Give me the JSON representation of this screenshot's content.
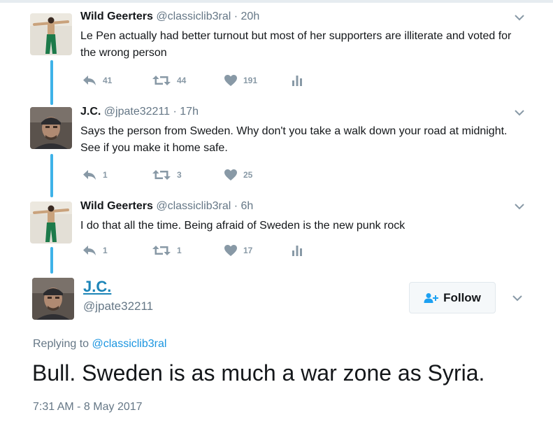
{
  "tweets": [
    {
      "name": "Wild Geerters",
      "handle": "@classiclib3ral",
      "separator": "·",
      "time": "20h",
      "text": "Le Pen actually had better turnout but most of her supporters are illiterate and voted for the wrong person",
      "replies": "41",
      "retweets": "44",
      "likes": "191",
      "avatar_icon": "man-arms-outstretched-photo",
      "has_analytics": true
    },
    {
      "name": "J.C.",
      "handle": "@jpate32211",
      "separator": "·",
      "time": "17h",
      "text": "Says the person from Sweden. Why don't you take a walk down your road at midnight. See if you make it home safe.",
      "replies": "1",
      "retweets": "3",
      "likes": "25",
      "avatar_icon": "man-in-cap-photo",
      "has_analytics": false
    },
    {
      "name": "Wild Geerters",
      "handle": "@classiclib3ral",
      "separator": "·",
      "time": "6h",
      "text": "I do that all the time. Being afraid of Sweden is the new punk rock",
      "replies": "1",
      "retweets": "1",
      "likes": "17",
      "avatar_icon": "man-arms-outstretched-photo",
      "has_analytics": true
    }
  ],
  "main": {
    "name": "J.C.",
    "handle": "@jpate32211",
    "follow_label": "Follow",
    "replying_prefix": "Replying to",
    "replying_handle": "@classiclib3ral",
    "text": "Bull. Sweden is as much a war zone as Syria.",
    "timestamp": "7:31 AM - 8 May 2017"
  },
  "colors": {
    "thread_line": "#3eb2e8",
    "link": "#1b95e0",
    "icon_gray": "#8899a6"
  }
}
